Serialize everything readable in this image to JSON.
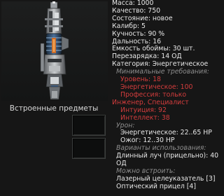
{
  "item": {
    "stats": {
      "mass": "Масса: 1000",
      "quality": "Качество: 750",
      "condition": "Состояние: новое",
      "caliber": "Калибр: 5",
      "accuracy": "Кучность: 90 %",
      "range": "Дальность: 16",
      "clip": "Емкость обоймы: 30 шт.",
      "reload": "Перезарядка: 14 ОД",
      "category": "Категория: Энергетическое"
    },
    "requirements": {
      "header": "Минимальные требования:",
      "items": [
        "Уровень: 18",
        "Энергетическое: 100",
        "Профессия: только Инженер, Специалист",
        "Интуиция: 92",
        "Интеллект: 38"
      ]
    },
    "damage": {
      "header": "Урон:",
      "items": [
        "Энергетическое: 22..65 HP",
        "Ожог: 12..30 HP"
      ]
    },
    "usage": {
      "header": "Варианты использования:",
      "items": [
        "Длинный луч (прицельно): 40 ОД"
      ]
    },
    "embed": {
      "header": "Можно встроить:",
      "items": [
        "Лазерный целеуказатель [3]",
        "Оптический прицел [4]"
      ]
    }
  },
  "embedded": {
    "label": "Встроенные предметы"
  },
  "icons": {
    "weapon": "energy-rifle-icon"
  },
  "colors": {
    "text": "#e8e8e8",
    "requirement": "#d43d3d",
    "section_header": "#8e8e8e"
  }
}
